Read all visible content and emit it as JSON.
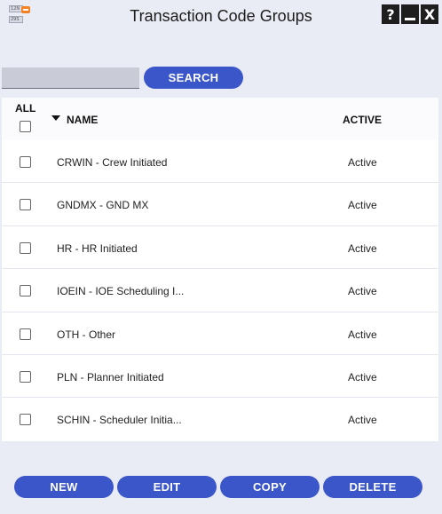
{
  "window": {
    "title": "Transaction Code Groups",
    "icon_text_top": "12N",
    "icon_text_bottom": "29S",
    "help_glyph": "?",
    "close_glyph": "X"
  },
  "search": {
    "value": "",
    "button_label": "SEARCH"
  },
  "table": {
    "select_all_label": "ALL",
    "headers": {
      "name": "NAME",
      "active": "ACTIVE"
    },
    "rows": [
      {
        "name": "CRWIN - Crew Initiated",
        "status": "Active"
      },
      {
        "name": "GNDMX - GND MX",
        "status": "Active"
      },
      {
        "name": "HR - HR Initiated",
        "status": "Active"
      },
      {
        "name": "IOEIN - IOE Scheduling I...",
        "status": "Active"
      },
      {
        "name": "OTH - Other",
        "status": "Active"
      },
      {
        "name": "PLN - Planner Initiated",
        "status": "Active"
      },
      {
        "name": "SCHIN - Scheduler Initia...",
        "status": "Active"
      }
    ]
  },
  "footer": {
    "new_label": "NEW",
    "edit_label": "EDIT",
    "copy_label": "COPY",
    "delete_label": "DELETE"
  },
  "colors": {
    "accent": "#3a56c9",
    "background": "#e9ebf5",
    "window_button": "#1e1e1e",
    "icon_badge": "#f58220"
  }
}
